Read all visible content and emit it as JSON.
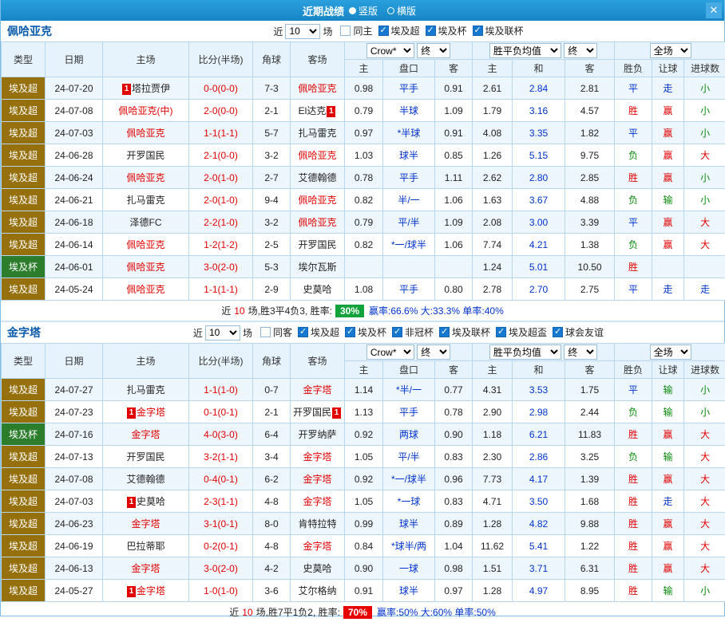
{
  "titlebar": {
    "title": "近期战绩",
    "radios": [
      {
        "label": "竖版",
        "selected": true
      },
      {
        "label": "横版",
        "selected": false
      }
    ],
    "close_icon": "✕"
  },
  "labels": {
    "near": "近",
    "games": "场"
  },
  "selects": {
    "count": "10",
    "bookmaker": "Crow*",
    "final_a": "终",
    "avg": "胜平负均值",
    "final_b": "终",
    "scope": "全场"
  },
  "columns": {
    "type": "类型",
    "date": "日期",
    "home": "主场",
    "score": "比分(半场)",
    "corner": "角球",
    "away": "客场",
    "odds_home": "主",
    "odds_handicap": "盘口",
    "odds_away": "客",
    "avg_home": "主",
    "avg_draw": "和",
    "avg_away": "客",
    "result": "胜负",
    "handicap_result": "让球",
    "goals": "进球数"
  },
  "colors": {
    "accent_blue": "#1b93d0",
    "win_red": "#e10000",
    "lose_green": "#0a8a0a",
    "draw_blue": "#0033cc",
    "league_super_bg": "#96700d",
    "league_cup_bg": "#2c7d2c",
    "rate_green_bg": "#12a33c",
    "rate_red_bg": "#e80000"
  },
  "sections": [
    {
      "team": "佩哈亚克",
      "filters": [
        {
          "label": "同主",
          "checked": false
        },
        {
          "label": "埃及超",
          "checked": true
        },
        {
          "label": "埃及杯",
          "checked": true
        },
        {
          "label": "埃及联杯",
          "checked": true
        }
      ],
      "rows": [
        {
          "lg": "埃及超",
          "lgc": "super",
          "dt": "24-07-20",
          "hb": "1",
          "hm": "塔拉贾伊",
          "hr": false,
          "sc": "0-0(0-0)",
          "cn": "7-3",
          "ab": "",
          "aw": "佩哈亚克",
          "ar": true,
          "o": [
            "0.98",
            "平手",
            "0.91"
          ],
          "e": [
            "2.61",
            "2.84",
            "2.81"
          ],
          "rs": [
            "平",
            "b"
          ],
          "hc": [
            "走",
            "b"
          ],
          "gl": [
            "小",
            "g"
          ]
        },
        {
          "lg": "埃及超",
          "lgc": "super",
          "dt": "24-07-08",
          "hb": "",
          "hm": "佩哈亚克(中)",
          "hr": true,
          "sc": "2-0(0-0)",
          "cn": "2-1",
          "ab": "1",
          "aw": "El达克",
          "ar": false,
          "o": [
            "0.79",
            "半球",
            "1.09"
          ],
          "e": [
            "1.79",
            "3.16",
            "4.57"
          ],
          "rs": [
            "胜",
            "r"
          ],
          "hc": [
            "赢",
            "r"
          ],
          "gl": [
            "小",
            "g"
          ]
        },
        {
          "lg": "埃及超",
          "lgc": "super",
          "dt": "24-07-03",
          "hb": "",
          "hm": "佩哈亚克",
          "hr": true,
          "sc": "1-1(1-1)",
          "cn": "5-7",
          "ab": "",
          "aw": "扎马雷克",
          "ar": false,
          "o": [
            "0.97",
            "*半球",
            "0.91"
          ],
          "e": [
            "4.08",
            "3.35",
            "1.82"
          ],
          "rs": [
            "平",
            "b"
          ],
          "hc": [
            "赢",
            "r"
          ],
          "gl": [
            "小",
            "g"
          ]
        },
        {
          "lg": "埃及超",
          "lgc": "super",
          "dt": "24-06-28",
          "hb": "",
          "hm": "开罗国民",
          "hr": false,
          "sc": "2-1(0-0)",
          "cn": "3-2",
          "ab": "",
          "aw": "佩哈亚克",
          "ar": true,
          "o": [
            "1.03",
            "球半",
            "0.85"
          ],
          "e": [
            "1.26",
            "5.15",
            "9.75"
          ],
          "rs": [
            "负",
            "g"
          ],
          "hc": [
            "赢",
            "r"
          ],
          "gl": [
            "大",
            "r"
          ]
        },
        {
          "lg": "埃及超",
          "lgc": "super",
          "dt": "24-06-24",
          "hb": "",
          "hm": "佩哈亚克",
          "hr": true,
          "sc": "2-0(1-0)",
          "cn": "2-7",
          "ab": "",
          "aw": "艾德翰德",
          "ar": false,
          "o": [
            "0.78",
            "平手",
            "1.11"
          ],
          "e": [
            "2.62",
            "2.80",
            "2.85"
          ],
          "rs": [
            "胜",
            "r"
          ],
          "hc": [
            "赢",
            "r"
          ],
          "gl": [
            "小",
            "g"
          ]
        },
        {
          "lg": "埃及超",
          "lgc": "super",
          "dt": "24-06-21",
          "hb": "",
          "hm": "扎马雷克",
          "hr": false,
          "sc": "2-0(1-0)",
          "cn": "9-4",
          "ab": "",
          "aw": "佩哈亚克",
          "ar": true,
          "o": [
            "0.82",
            "半/一",
            "1.06"
          ],
          "e": [
            "1.63",
            "3.67",
            "4.88"
          ],
          "rs": [
            "负",
            "g"
          ],
          "hc": [
            "输",
            "g"
          ],
          "gl": [
            "小",
            "g"
          ]
        },
        {
          "lg": "埃及超",
          "lgc": "super",
          "dt": "24-06-18",
          "hb": "",
          "hm": "泽德FC",
          "hr": false,
          "sc": "2-2(1-0)",
          "cn": "3-2",
          "ab": "",
          "aw": "佩哈亚克",
          "ar": true,
          "o": [
            "0.79",
            "平/半",
            "1.09"
          ],
          "e": [
            "2.08",
            "3.00",
            "3.39"
          ],
          "rs": [
            "平",
            "b"
          ],
          "hc": [
            "赢",
            "r"
          ],
          "gl": [
            "大",
            "r"
          ]
        },
        {
          "lg": "埃及超",
          "lgc": "super",
          "dt": "24-06-14",
          "hb": "",
          "hm": "佩哈亚克",
          "hr": true,
          "sc": "1-2(1-2)",
          "cn": "2-5",
          "ab": "",
          "aw": "开罗国民",
          "ar": false,
          "o": [
            "0.82",
            "*一/球半",
            "1.06"
          ],
          "e": [
            "7.74",
            "4.21",
            "1.38"
          ],
          "rs": [
            "负",
            "g"
          ],
          "hc": [
            "赢",
            "r"
          ],
          "gl": [
            "大",
            "r"
          ]
        },
        {
          "lg": "埃及杯",
          "lgc": "cup",
          "dt": "24-06-01",
          "hb": "",
          "hm": "佩哈亚克",
          "hr": true,
          "sc": "3-0(2-0)",
          "cn": "5-3",
          "ab": "",
          "aw": "埃尔瓦斯",
          "ar": false,
          "o": [
            "",
            "",
            ""
          ],
          "e": [
            "1.24",
            "5.01",
            "10.50"
          ],
          "rs": [
            "胜",
            "r"
          ],
          "hc": [
            "",
            ""
          ],
          "gl": [
            "",
            ""
          ]
        },
        {
          "lg": "埃及超",
          "lgc": "super",
          "dt": "24-05-24",
          "hb": "",
          "hm": "佩哈亚克",
          "hr": true,
          "sc": "1-1(1-1)",
          "cn": "2-9",
          "ab": "",
          "aw": "史莫哈",
          "ar": false,
          "o": [
            "1.08",
            "平手",
            "0.80"
          ],
          "e": [
            "2.78",
            "2.70",
            "2.75"
          ],
          "rs": [
            "平",
            "b"
          ],
          "hc": [
            "走",
            "b"
          ],
          "gl": [
            "走",
            "b"
          ]
        }
      ],
      "summary": {
        "pre": "近",
        "count": "10",
        "mid": "场,胜3平4负3, 胜率:",
        "rate": "30%",
        "rc": "green",
        "tail": "赢率:66.6% 大:33.3% 单率:40%"
      }
    },
    {
      "team": "金字塔",
      "filters": [
        {
          "label": "同客",
          "checked": false
        },
        {
          "label": "埃及超",
          "checked": true
        },
        {
          "label": "埃及杯",
          "checked": true
        },
        {
          "label": "非冠杯",
          "checked": true
        },
        {
          "label": "埃及联杯",
          "checked": true
        },
        {
          "label": "埃及超盃",
          "checked": true
        },
        {
          "label": "球会友谊",
          "checked": true
        }
      ],
      "rows": [
        {
          "lg": "埃及超",
          "lgc": "super",
          "dt": "24-07-27",
          "hb": "",
          "hm": "扎马雷克",
          "hr": false,
          "sc": "1-1(1-0)",
          "cn": "0-7",
          "ab": "",
          "aw": "金字塔",
          "ar": true,
          "o": [
            "1.14",
            "*半/一",
            "0.77"
          ],
          "e": [
            "4.31",
            "3.53",
            "1.75"
          ],
          "rs": [
            "平",
            "b"
          ],
          "hc": [
            "输",
            "g"
          ],
          "gl": [
            "小",
            "g"
          ]
        },
        {
          "lg": "埃及超",
          "lgc": "super",
          "dt": "24-07-23",
          "hb": "1",
          "hm": "金字塔",
          "hr": true,
          "sc": "0-1(0-1)",
          "cn": "2-1",
          "ab": "1",
          "aw": "开罗国民",
          "ar": false,
          "o": [
            "1.13",
            "平手",
            "0.78"
          ],
          "e": [
            "2.90",
            "2.98",
            "2.44"
          ],
          "rs": [
            "负",
            "g"
          ],
          "hc": [
            "输",
            "g"
          ],
          "gl": [
            "小",
            "g"
          ]
        },
        {
          "lg": "埃及杯",
          "lgc": "cup",
          "dt": "24-07-16",
          "hb": "",
          "hm": "金字塔",
          "hr": true,
          "sc": "4-0(3-0)",
          "cn": "6-4",
          "ab": "",
          "aw": "开罗纳萨",
          "ar": false,
          "o": [
            "0.92",
            "两球",
            "0.90"
          ],
          "e": [
            "1.18",
            "6.21",
            "11.83"
          ],
          "rs": [
            "胜",
            "r"
          ],
          "hc": [
            "赢",
            "r"
          ],
          "gl": [
            "大",
            "r"
          ]
        },
        {
          "lg": "埃及超",
          "lgc": "super",
          "dt": "24-07-13",
          "hb": "",
          "hm": "开罗国民",
          "hr": false,
          "sc": "3-2(1-1)",
          "cn": "3-4",
          "ab": "",
          "aw": "金字塔",
          "ar": true,
          "o": [
            "1.05",
            "平/半",
            "0.83"
          ],
          "e": [
            "2.30",
            "2.86",
            "3.25"
          ],
          "rs": [
            "负",
            "g"
          ],
          "hc": [
            "输",
            "g"
          ],
          "gl": [
            "大",
            "r"
          ]
        },
        {
          "lg": "埃及超",
          "lgc": "super",
          "dt": "24-07-08",
          "hb": "",
          "hm": "艾德翰德",
          "hr": false,
          "sc": "0-4(0-1)",
          "cn": "6-2",
          "ab": "",
          "aw": "金字塔",
          "ar": true,
          "o": [
            "0.92",
            "*一/球半",
            "0.96"
          ],
          "e": [
            "7.73",
            "4.17",
            "1.39"
          ],
          "rs": [
            "胜",
            "r"
          ],
          "hc": [
            "赢",
            "r"
          ],
          "gl": [
            "大",
            "r"
          ]
        },
        {
          "lg": "埃及超",
          "lgc": "super",
          "dt": "24-07-03",
          "hb": "1",
          "hm": "史莫哈",
          "hr": false,
          "sc": "2-3(1-1)",
          "cn": "4-8",
          "ab": "",
          "aw": "金字塔",
          "ar": true,
          "o": [
            "1.05",
            "*一球",
            "0.83"
          ],
          "e": [
            "4.71",
            "3.50",
            "1.68"
          ],
          "rs": [
            "胜",
            "r"
          ],
          "hc": [
            "走",
            "b"
          ],
          "gl": [
            "大",
            "r"
          ]
        },
        {
          "lg": "埃及超",
          "lgc": "super",
          "dt": "24-06-23",
          "hb": "",
          "hm": "金字塔",
          "hr": true,
          "sc": "3-1(0-1)",
          "cn": "8-0",
          "ab": "",
          "aw": "肯特拉特",
          "ar": false,
          "o": [
            "0.99",
            "球半",
            "0.89"
          ],
          "e": [
            "1.28",
            "4.82",
            "9.88"
          ],
          "rs": [
            "胜",
            "r"
          ],
          "hc": [
            "赢",
            "r"
          ],
          "gl": [
            "大",
            "r"
          ]
        },
        {
          "lg": "埃及超",
          "lgc": "super",
          "dt": "24-06-19",
          "hb": "",
          "hm": "巴拉蒂耶",
          "hr": false,
          "sc": "0-2(0-1)",
          "cn": "4-8",
          "ab": "",
          "aw": "金字塔",
          "ar": true,
          "o": [
            "0.84",
            "*球半/两",
            "1.04"
          ],
          "e": [
            "11.62",
            "5.41",
            "1.22"
          ],
          "rs": [
            "胜",
            "r"
          ],
          "hc": [
            "赢",
            "r"
          ],
          "gl": [
            "大",
            "r"
          ]
        },
        {
          "lg": "埃及超",
          "lgc": "super",
          "dt": "24-06-13",
          "hb": "",
          "hm": "金字塔",
          "hr": true,
          "sc": "3-0(2-0)",
          "cn": "4-2",
          "ab": "",
          "aw": "史莫哈",
          "ar": false,
          "o": [
            "0.90",
            "一球",
            "0.98"
          ],
          "e": [
            "1.51",
            "3.71",
            "6.31"
          ],
          "rs": [
            "胜",
            "r"
          ],
          "hc": [
            "赢",
            "r"
          ],
          "gl": [
            "大",
            "r"
          ]
        },
        {
          "lg": "埃及超",
          "lgc": "super",
          "dt": "24-05-27",
          "hb": "1",
          "hm": "金字塔",
          "hr": true,
          "sc": "1-0(1-0)",
          "cn": "3-6",
          "ab": "",
          "aw": "艾尔格纳",
          "ar": false,
          "o": [
            "0.91",
            "球半",
            "0.97"
          ],
          "e": [
            "1.28",
            "4.97",
            "8.95"
          ],
          "rs": [
            "胜",
            "r"
          ],
          "hc": [
            "输",
            "g"
          ],
          "gl": [
            "小",
            "g"
          ]
        }
      ],
      "summary": {
        "pre": "近",
        "count": "10",
        "mid": "场,胜7平1负2, 胜率:",
        "rate": "70%",
        "rc": "red",
        "tail": "赢率:50% 大:60% 单率:50%"
      }
    }
  ]
}
